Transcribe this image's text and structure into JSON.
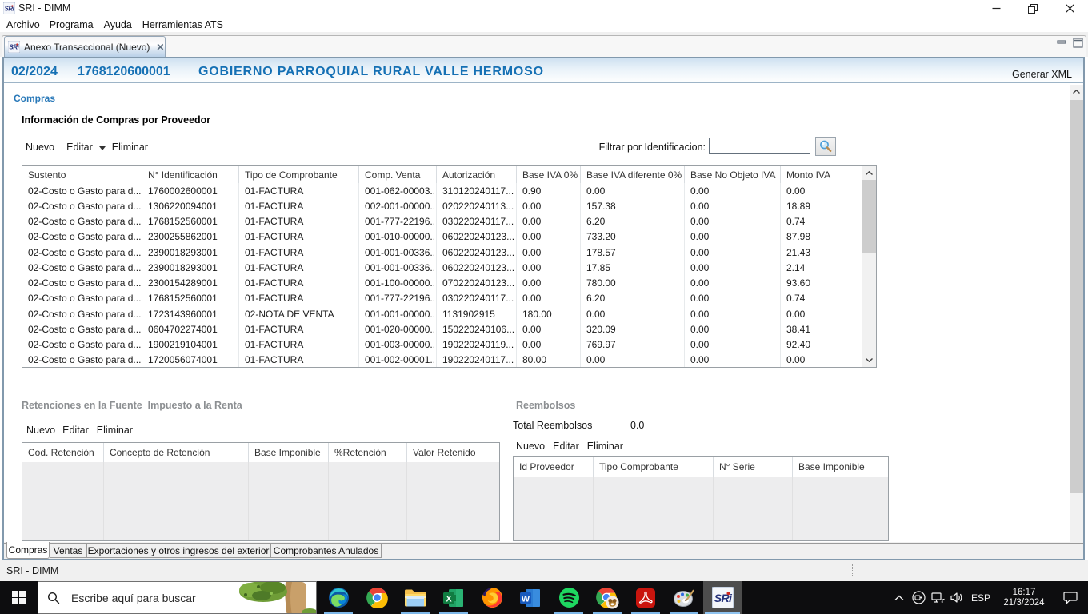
{
  "window": {
    "title": "SRI - DIMM",
    "caption_buttons": [
      "minimize",
      "restore",
      "close"
    ]
  },
  "menu_bar": {
    "items": [
      "Archivo",
      "Programa",
      "Ayuda",
      "Herramientas ATS"
    ]
  },
  "editor_tab": {
    "label": "Anexo Transaccional (Nuevo)"
  },
  "header": {
    "period": "02/2024",
    "ruc": "1768120600001",
    "taxpayer": "GOBIERNO PARROQUIAL RURAL VALLE HERMOSO",
    "action": "Generar XML"
  },
  "compras": {
    "section_title": "Compras",
    "subtitle": "Información de Compras por Proveedor",
    "toolbar": {
      "nuevo": "Nuevo",
      "editar": "Editar",
      "eliminar": "Eliminar"
    },
    "filter_label": "Filtrar por Identificacion:",
    "filter_value": "",
    "table": {
      "columns": [
        "Sustento",
        "N° Identificación",
        "Tipo de Comprobante",
        "Comp. Venta",
        "Autorización",
        "Base IVA 0%",
        "Base IVA diferente 0%",
        "Base No Objeto IVA",
        "Monto IVA"
      ],
      "rows": [
        [
          "02-Costo o Gasto para d...",
          "1760002600001",
          "01-FACTURA",
          "001-062-00003...",
          "310120240117...",
          "0.90",
          "0.00",
          "0.00",
          "0.00"
        ],
        [
          "02-Costo o Gasto para d...",
          "1306220094001",
          "01-FACTURA",
          "002-001-00000...",
          "020220240113...",
          "0.00",
          "157.38",
          "0.00",
          "18.89"
        ],
        [
          "02-Costo o Gasto para d...",
          "1768152560001",
          "01-FACTURA",
          "001-777-22196...",
          "030220240117...",
          "0.00",
          "6.20",
          "0.00",
          "0.74"
        ],
        [
          "02-Costo o Gasto para d...",
          "2300255862001",
          "01-FACTURA",
          "001-010-00000...",
          "060220240123...",
          "0.00",
          "733.20",
          "0.00",
          "87.98"
        ],
        [
          "02-Costo o Gasto para d...",
          "2390018293001",
          "01-FACTURA",
          "001-001-00336...",
          "060220240123...",
          "0.00",
          "178.57",
          "0.00",
          "21.43"
        ],
        [
          "02-Costo o Gasto para d...",
          "2390018293001",
          "01-FACTURA",
          "001-001-00336...",
          "060220240123...",
          "0.00",
          "17.85",
          "0.00",
          "2.14"
        ],
        [
          "02-Costo o Gasto para d...",
          "2300154289001",
          "01-FACTURA",
          "001-100-00000...",
          "070220240123...",
          "0.00",
          "780.00",
          "0.00",
          "93.60"
        ],
        [
          "02-Costo o Gasto para d...",
          "1768152560001",
          "01-FACTURA",
          "001-777-22196...",
          "030220240117...",
          "0.00",
          "6.20",
          "0.00",
          "0.74"
        ],
        [
          "02-Costo o Gasto para d...",
          "1723143960001",
          "02-NOTA DE VENTA",
          "001-001-00000...",
          "1131902915",
          "180.00",
          "0.00",
          "0.00",
          "0.00"
        ],
        [
          "02-Costo o Gasto para d...",
          "0604702274001",
          "01-FACTURA",
          "001-020-00000...",
          "150220240106...",
          "0.00",
          "320.09",
          "0.00",
          "38.41"
        ],
        [
          "02-Costo o Gasto para d...",
          "1900219104001",
          "01-FACTURA",
          "001-003-00000...",
          "190220240119...",
          "0.00",
          "769.97",
          "0.00",
          "92.40"
        ],
        [
          "02-Costo o Gasto para d...",
          "1720056074001",
          "01-FACTURA",
          "001-002-00001...",
          "190220240117...",
          "80.00",
          "0.00",
          "0.00",
          "0.00"
        ]
      ]
    }
  },
  "retenciones": {
    "title": "Retenciones en la Fuente  Impuesto a la Renta",
    "toolbar": {
      "nuevo": "Nuevo",
      "editar": "Editar",
      "eliminar": "Eliminar"
    },
    "table": {
      "columns": [
        "Cod. Retención",
        "Concepto de Retención",
        "Base Imponible",
        "%Retención",
        "Valor Retenido"
      ],
      "rows": []
    }
  },
  "reembolsos": {
    "title": "Reembolsos",
    "total_label": "Total Reembolsos",
    "total_value": "0.0",
    "toolbar": {
      "nuevo": "Nuevo",
      "editar": "Editar",
      "eliminar": "Eliminar"
    },
    "table": {
      "columns": [
        "Id Proveedor",
        "Tipo Comprobante",
        "N° Serie",
        "Base Imponible"
      ],
      "rows": []
    }
  },
  "bottom_tabs": {
    "active": "Compras",
    "items": [
      "Compras",
      "Ventas",
      "Exportaciones y otros ingresos del exterior",
      "Comprobantes Anulados"
    ]
  },
  "status_bar": {
    "text": "SRI - DIMM"
  },
  "taskbar": {
    "search_placeholder": "Escribe aquí para buscar",
    "apps": [
      {
        "id": "edge",
        "running": true,
        "active": false
      },
      {
        "id": "chrome",
        "running": false,
        "active": false
      },
      {
        "id": "file-explorer",
        "running": true,
        "active": false
      },
      {
        "id": "excel",
        "running": true,
        "active": false
      },
      {
        "id": "firefox",
        "running": false,
        "active": false
      },
      {
        "id": "word",
        "running": false,
        "active": false
      },
      {
        "id": "spotify",
        "running": true,
        "active": false
      },
      {
        "id": "chrome-profile",
        "running": true,
        "active": false
      },
      {
        "id": "acrobat",
        "running": true,
        "active": false
      },
      {
        "id": "paint",
        "running": true,
        "active": false
      },
      {
        "id": "sri-dimm",
        "running": true,
        "active": true
      }
    ],
    "tray": {
      "language": "ESP",
      "time": "16:17",
      "date": "21/3/2024"
    }
  },
  "colors": {
    "accent_blue_text": "#1570b4",
    "frame_border": "#8299ad",
    "taskbar_bg": "#0d0d0f",
    "running_underline": "#7db7e8"
  }
}
